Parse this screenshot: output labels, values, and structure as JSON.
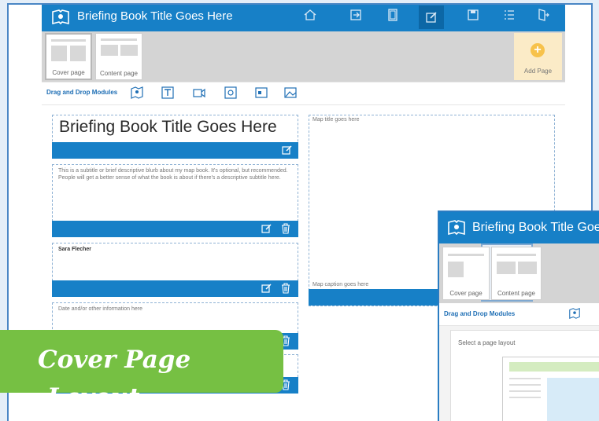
{
  "app": {
    "title": "Briefing Book Title Goes Here",
    "toolbar_icons": [
      "home-icon",
      "exit-icon",
      "page-icon",
      "edit-icon",
      "save-icon",
      "list-icon",
      "logout-icon"
    ]
  },
  "pages": {
    "cover_label": "Cover page",
    "content_label": "Content page",
    "add_label": "Add Page"
  },
  "modules": {
    "label": "Drag and Drop Modules",
    "icons": [
      "map-module-icon",
      "text-module-icon",
      "video-module-icon",
      "link-module-icon",
      "image-module-icon",
      "picture-module-icon"
    ]
  },
  "cover": {
    "title": "Briefing Book Title Goes Here",
    "subtitle": "This is a subtitle or brief descriptive blurb about my map book. It's optional, but recommended. People will get a better sense of what the book is about if there's a descriptive subtitle here.",
    "author": "Sara Flecher",
    "date": "Date and/or other information here",
    "map_title": "Map title goes here",
    "map_caption": "Map caption goes here"
  },
  "banner": {
    "line1": "Cover Page",
    "line2": "Layout"
  },
  "inset": {
    "title": "Briefing Book Title Goes Here",
    "cover_label": "Cover page",
    "content_label": "Content page",
    "modules_label": "Drag and Drop Modules",
    "select_layout": "Select a page layout"
  },
  "colors": {
    "primary": "#1780c7",
    "banner": "#76c043",
    "add_page_bg": "#fbebc7"
  }
}
